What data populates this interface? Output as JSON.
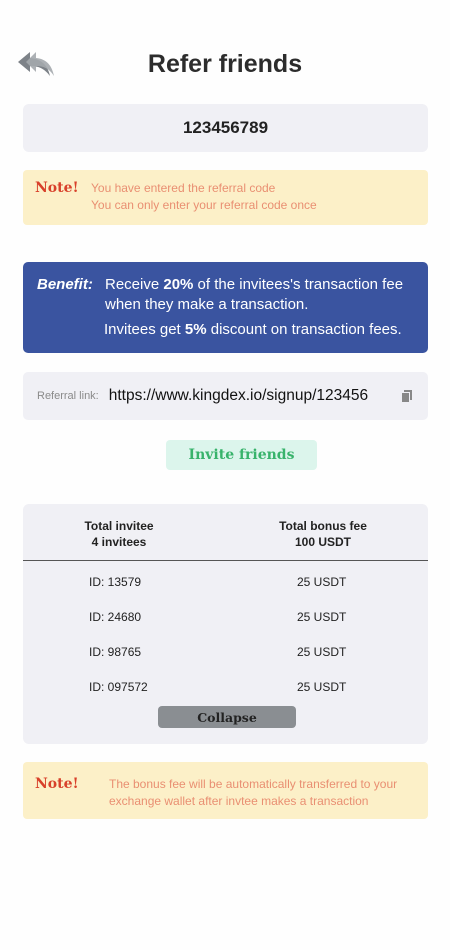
{
  "header": {
    "title": "Refer friends",
    "back_icon": "double-back-arrow-icon"
  },
  "referral_code": "123456789",
  "note_top": {
    "label": "Note!",
    "line1": "You have entered the referral code",
    "line2": "You can only enter your referral code once"
  },
  "benefit": {
    "label": "Benefit:",
    "line1_prefix": "Receive ",
    "line1_percent": "20%",
    "line1_suffix": " of the invitees's transaction fee when they make a transaction.",
    "line2_prefix": "Invitees get ",
    "line2_percent": "5%",
    "line2_suffix": " discount on transaction fees."
  },
  "referral_link": {
    "label": "Referral link:",
    "url": "https://www.kingdex.io/signup/123456",
    "copy_icon": "copy-icon"
  },
  "invite_button": "Invite friends",
  "invitees": {
    "col1_header": "Total invitee",
    "col1_value": "4 invitees",
    "col2_header": "Total bonus fee",
    "col2_value": "100 USDT",
    "rows": [
      {
        "id": "ID: 13579",
        "amount": "25 USDT"
      },
      {
        "id": "ID: 24680",
        "amount": "25 USDT"
      },
      {
        "id": "ID: 98765",
        "amount": "25 USDT"
      },
      {
        "id": "ID: 097572",
        "amount": "25 USDT"
      }
    ],
    "collapse_label": "Collapse"
  },
  "note_bottom": {
    "label": "Note!",
    "text": "The bonus fee will be automatically transferred to your exchange wallet after invtee makes a transaction"
  },
  "colors": {
    "benefit_bg": "#3a54a0",
    "note_bg": "#fcf0c8",
    "note_label": "#d8402a",
    "note_text": "#e98f72",
    "invite_bg": "#dcf5ec",
    "invite_text": "#38b36b",
    "card_bg": "#f0f0f5"
  }
}
